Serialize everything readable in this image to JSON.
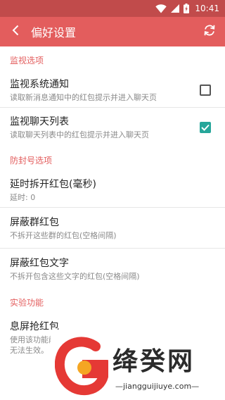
{
  "status_bar": {
    "time": "10:41"
  },
  "app_bar": {
    "title": "偏好设置"
  },
  "sections": {
    "monitor": {
      "header": "监视选项",
      "items": [
        {
          "title": "监视系统通知",
          "summary": "读取新消息通知中的红包提示并进入聊天页",
          "checked": false
        },
        {
          "title": "监视聊天列表",
          "summary": "读取聊天列表中的红包提示并进入聊天页",
          "checked": true
        }
      ]
    },
    "anti_ban": {
      "header": "防封号选项",
      "items": [
        {
          "title": "延时拆开红包(毫秒)",
          "summary": "延时: 0"
        },
        {
          "title": "屏蔽群红包",
          "summary": "不拆开这些群的红包(空格间隔)"
        },
        {
          "title": "屏蔽红包文字",
          "summary": "不拆开包含这些文字的红包(空格间隔)"
        }
      ]
    },
    "experimental": {
      "header": "实验功能",
      "items": [
        {
          "title": "息屏抢红包",
          "summary_line1": "使用该功能前需打开“监听系统通知”功能，否则",
          "summary_line2": "无法生效。",
          "checked": false
        }
      ]
    }
  },
  "watermark": {
    "name": "绛癸网",
    "url": "—jiangguijiuye.com—"
  },
  "colors": {
    "status_bar": "#c14b4b",
    "app_bar": "#e35d5d",
    "section_header": "#e35d5d",
    "checkbox_checked": "#26a69a"
  }
}
